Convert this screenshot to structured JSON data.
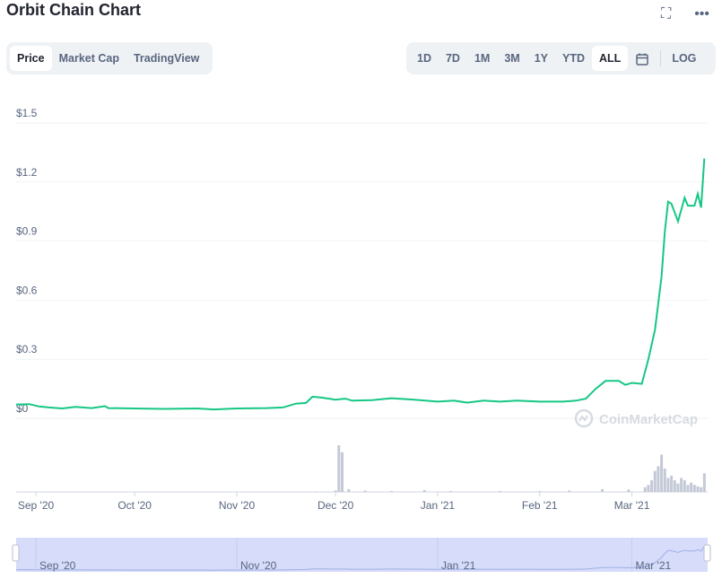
{
  "header": {
    "title": "Orbit Chain Chart",
    "fullscreen_icon": "expand-icon",
    "more_icon": "more-horizontal-icon"
  },
  "chart_type_tabs": [
    {
      "label": "Price",
      "active": true
    },
    {
      "label": "Market Cap",
      "active": false
    },
    {
      "label": "TradingView",
      "active": false
    }
  ],
  "range_tabs": [
    {
      "label": "1D",
      "active": false
    },
    {
      "label": "7D",
      "active": false
    },
    {
      "label": "1M",
      "active": false
    },
    {
      "label": "3M",
      "active": false
    },
    {
      "label": "1Y",
      "active": false
    },
    {
      "label": "YTD",
      "active": false
    },
    {
      "label": "ALL",
      "active": true
    }
  ],
  "calendar_icon": "calendar-icon",
  "log_label": "LOG",
  "watermark": "CoinMarketCap",
  "colors": {
    "line": "#16c784",
    "volume": "#c3c9d6",
    "navigator": "#d6dcfa"
  },
  "chart_data": {
    "type": "line",
    "title": "Orbit Chain Chart",
    "ylabel": "",
    "xlabel": "",
    "ylim": [
      0,
      1.5
    ],
    "y_ticks": [
      "$0",
      "$0.3",
      "$0.6",
      "$0.9",
      "$1.2",
      "$1.5"
    ],
    "y_tick_values": [
      0,
      0.3,
      0.6,
      0.9,
      1.2,
      1.5
    ],
    "x_ticks": [
      "Sep '20",
      "Oct '20",
      "Nov '20",
      "Dec '20",
      "Jan '21",
      "Feb '21",
      "Mar '21"
    ],
    "x_tick_dates": [
      "2020-09-01",
      "2020-10-01",
      "2020-11-01",
      "2020-12-01",
      "2021-01-01",
      "2021-02-01",
      "2021-03-01"
    ],
    "xlim": [
      "2020-08-26",
      "2021-03-24"
    ],
    "navigator_ticks": [
      "Sep '20",
      "Nov '20",
      "Jan '21",
      "Mar '21"
    ],
    "navigator_tick_dates": [
      "2020-09-01",
      "2020-11-01",
      "2021-01-01",
      "2021-03-01"
    ],
    "grid": true,
    "series": [
      {
        "values": [
          [
            "2020-08-26",
            0.07
          ],
          [
            "2020-08-30",
            0.072
          ],
          [
            "2020-09-02",
            0.06
          ],
          [
            "2020-09-05",
            0.055
          ],
          [
            "2020-09-09",
            0.05
          ],
          [
            "2020-09-13",
            0.058
          ],
          [
            "2020-09-18",
            0.052
          ],
          [
            "2020-09-22",
            0.062
          ],
          [
            "2020-09-23",
            0.052
          ],
          [
            "2020-10-01",
            0.05
          ],
          [
            "2020-10-10",
            0.048
          ],
          [
            "2020-10-20",
            0.05
          ],
          [
            "2020-10-25",
            0.045
          ],
          [
            "2020-11-01",
            0.05
          ],
          [
            "2020-11-10",
            0.052
          ],
          [
            "2020-11-15",
            0.055
          ],
          [
            "2020-11-19",
            0.075
          ],
          [
            "2020-11-22",
            0.078
          ],
          [
            "2020-11-24",
            0.11
          ],
          [
            "2020-11-27",
            0.105
          ],
          [
            "2020-12-01",
            0.095
          ],
          [
            "2020-12-04",
            0.1
          ],
          [
            "2020-12-06",
            0.09
          ],
          [
            "2020-12-12",
            0.092
          ],
          [
            "2020-12-18",
            0.102
          ],
          [
            "2020-12-25",
            0.095
          ],
          [
            "2021-01-01",
            0.085
          ],
          [
            "2021-01-06",
            0.09
          ],
          [
            "2021-01-10",
            0.08
          ],
          [
            "2021-01-15",
            0.09
          ],
          [
            "2021-01-20",
            0.085
          ],
          [
            "2021-01-25",
            0.09
          ],
          [
            "2021-02-01",
            0.085
          ],
          [
            "2021-02-08",
            0.085
          ],
          [
            "2021-02-12",
            0.09
          ],
          [
            "2021-02-15",
            0.1
          ],
          [
            "2021-02-18",
            0.15
          ],
          [
            "2021-02-21",
            0.19
          ],
          [
            "2021-02-25",
            0.19
          ],
          [
            "2021-02-27",
            0.17
          ],
          [
            "2021-03-01",
            0.18
          ],
          [
            "2021-03-04",
            0.175
          ],
          [
            "2021-03-06",
            0.3
          ],
          [
            "2021-03-08",
            0.45
          ],
          [
            "2021-03-10",
            0.72
          ],
          [
            "2021-03-11",
            0.95
          ],
          [
            "2021-03-12",
            1.1
          ],
          [
            "2021-03-13",
            1.09
          ],
          [
            "2021-03-15",
            1.0
          ],
          [
            "2021-03-17",
            1.12
          ],
          [
            "2021-03-18",
            1.08
          ],
          [
            "2021-03-20",
            1.08
          ],
          [
            "2021-03-21",
            1.14
          ],
          [
            "2021-03-22",
            1.07
          ],
          [
            "2021-03-23",
            1.32
          ]
        ]
      }
    ],
    "volume": [
      [
        "2020-11-15",
        0.01
      ],
      [
        "2020-11-25",
        0.01
      ],
      [
        "2020-12-01",
        0.03
      ],
      [
        "2020-12-02",
        1.0
      ],
      [
        "2020-12-03",
        0.85
      ],
      [
        "2020-12-05",
        0.06
      ],
      [
        "2020-12-10",
        0.03
      ],
      [
        "2020-12-18",
        0.02
      ],
      [
        "2020-12-28",
        0.04
      ],
      [
        "2021-01-05",
        0.02
      ],
      [
        "2021-01-20",
        0.02
      ],
      [
        "2021-02-01",
        0.02
      ],
      [
        "2021-02-10",
        0.03
      ],
      [
        "2021-02-20",
        0.06
      ],
      [
        "2021-02-28",
        0.05
      ],
      [
        "2021-03-05",
        0.1
      ],
      [
        "2021-03-06",
        0.15
      ],
      [
        "2021-03-07",
        0.25
      ],
      [
        "2021-03-08",
        0.45
      ],
      [
        "2021-03-09",
        0.55
      ],
      [
        "2021-03-10",
        0.8
      ],
      [
        "2021-03-11",
        0.5
      ],
      [
        "2021-03-12",
        0.3
      ],
      [
        "2021-03-13",
        0.35
      ],
      [
        "2021-03-14",
        0.25
      ],
      [
        "2021-03-15",
        0.18
      ],
      [
        "2021-03-16",
        0.3
      ],
      [
        "2021-03-17",
        0.25
      ],
      [
        "2021-03-18",
        0.15
      ],
      [
        "2021-03-19",
        0.2
      ],
      [
        "2021-03-20",
        0.15
      ],
      [
        "2021-03-21",
        0.12
      ],
      [
        "2021-03-22",
        0.1
      ],
      [
        "2021-03-23",
        0.4
      ]
    ]
  }
}
